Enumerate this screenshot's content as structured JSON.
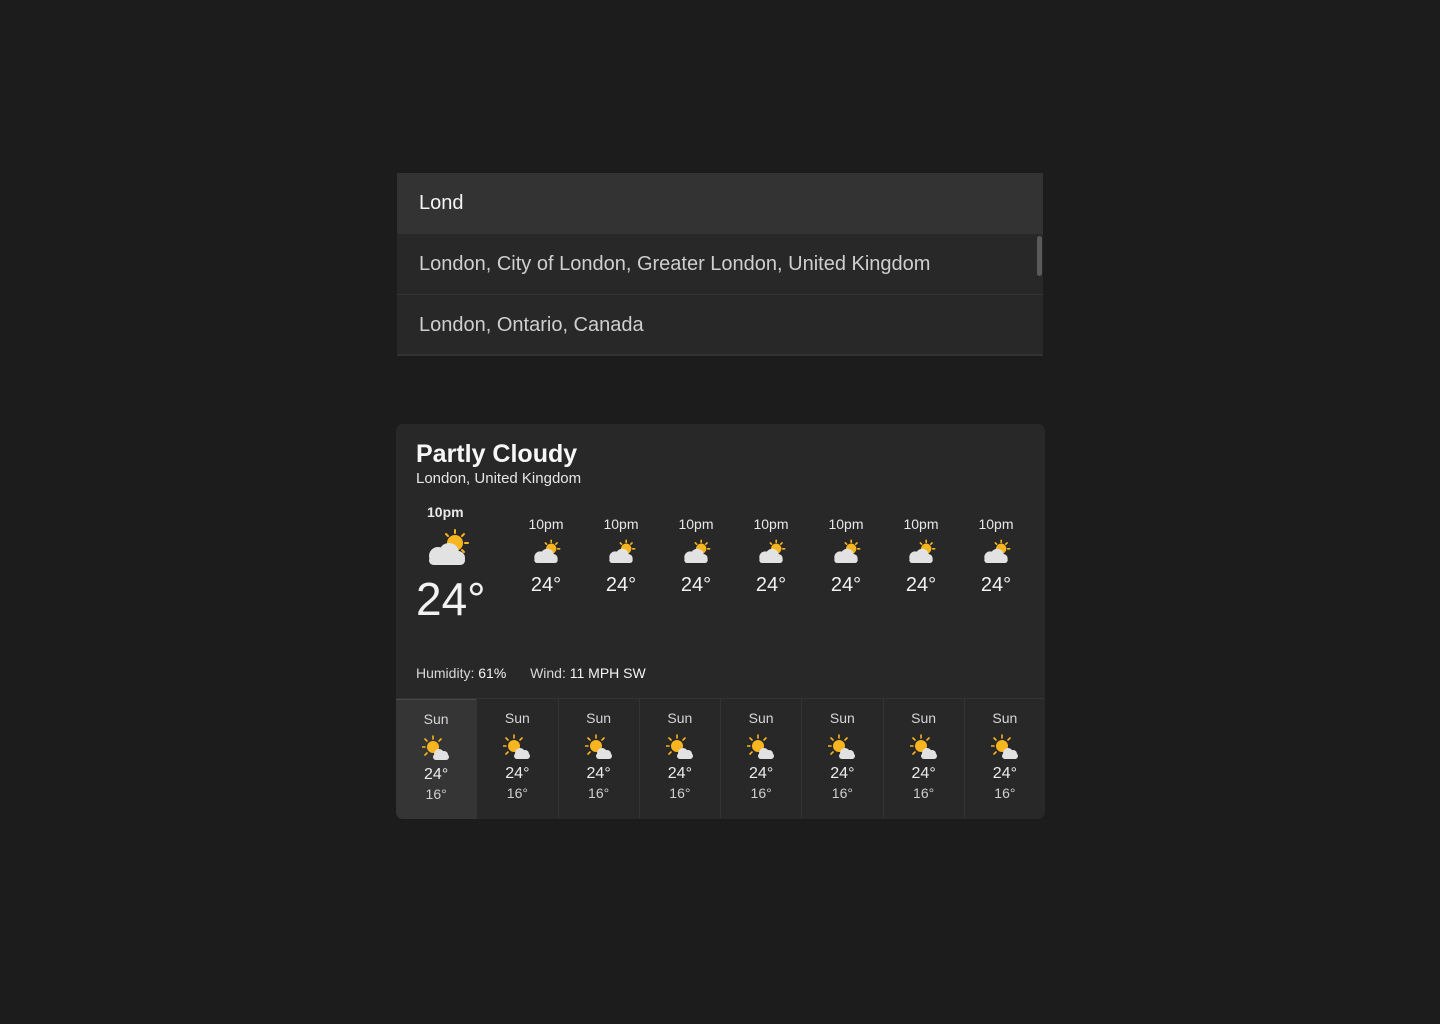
{
  "search": {
    "value": "Lond",
    "suggestions": [
      "London, City of London, Greater London, United Kingdom",
      "London, Ontario, Canada"
    ]
  },
  "weather": {
    "condition": "Partly Cloudy",
    "location": "London, United Kingdom",
    "hourly": [
      {
        "time": "10pm",
        "temp": "24°",
        "icon": "partly-cloudy-icon"
      },
      {
        "time": "10pm",
        "temp": "24°",
        "icon": "partly-cloudy-icon"
      },
      {
        "time": "10pm",
        "temp": "24°",
        "icon": "partly-cloudy-icon"
      },
      {
        "time": "10pm",
        "temp": "24°",
        "icon": "partly-cloudy-icon"
      },
      {
        "time": "10pm",
        "temp": "24°",
        "icon": "partly-cloudy-icon"
      },
      {
        "time": "10pm",
        "temp": "24°",
        "icon": "partly-cloudy-icon"
      },
      {
        "time": "10pm",
        "temp": "24°",
        "icon": "partly-cloudy-icon"
      },
      {
        "time": "10pm",
        "temp": "24°",
        "icon": "partly-cloudy-icon"
      }
    ],
    "humidity_label": "Humidity:",
    "humidity": "61%",
    "wind_label": "Wind:",
    "wind": "11 MPH SW",
    "daily": [
      {
        "day": "Sun",
        "high": "24°",
        "low": "16°",
        "icon": "sun-cloud-icon"
      },
      {
        "day": "Sun",
        "high": "24°",
        "low": "16°",
        "icon": "sun-cloud-icon"
      },
      {
        "day": "Sun",
        "high": "24°",
        "low": "16°",
        "icon": "sun-cloud-icon"
      },
      {
        "day": "Sun",
        "high": "24°",
        "low": "16°",
        "icon": "sun-cloud-icon"
      },
      {
        "day": "Sun",
        "high": "24°",
        "low": "16°",
        "icon": "sun-cloud-icon"
      },
      {
        "day": "Sun",
        "high": "24°",
        "low": "16°",
        "icon": "sun-cloud-icon"
      },
      {
        "day": "Sun",
        "high": "24°",
        "low": "16°",
        "icon": "sun-cloud-icon"
      },
      {
        "day": "Sun",
        "high": "24°",
        "low": "16°",
        "icon": "sun-cloud-icon"
      }
    ],
    "selected_day_index": 0
  },
  "colors": {
    "background": "#1c1c1c",
    "panel": "#282828",
    "sun": "#f7b51f",
    "cloud": "#e2e2e2"
  }
}
